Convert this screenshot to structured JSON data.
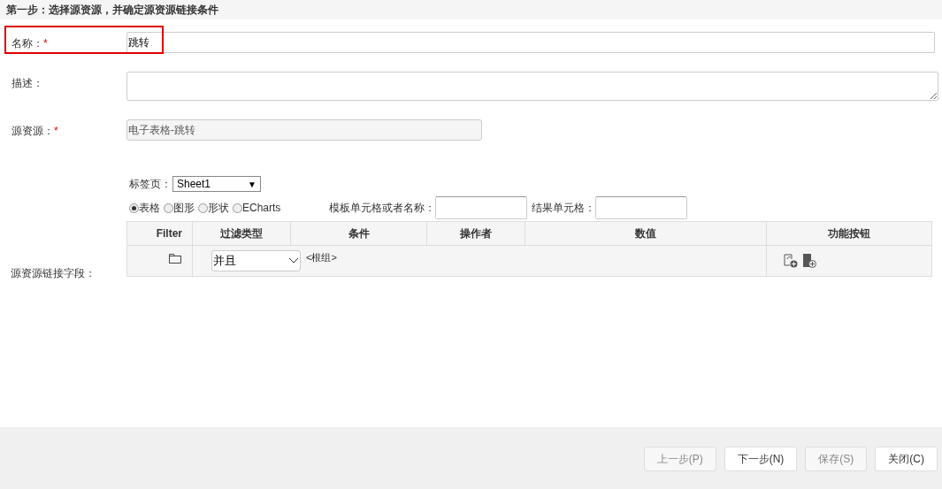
{
  "header": {
    "title": "第一步：选择源资源，并确定源资源链接条件"
  },
  "fields": [
    {
      "kind": "input",
      "label": "名称：",
      "required": "*",
      "value": "跳转",
      "highlighted": true
    },
    {
      "kind": "textarea",
      "label": "描述：",
      "highlighted": false
    },
    {
      "kind": "readonly",
      "label": "源资源：",
      "required": "*",
      "value": "电子表格-跳转",
      "highlighted": false
    }
  ],
  "link": {
    "label": "源资源链接字段：",
    "sheet_label": "标签页：",
    "sheet_value": "Sheet1",
    "sheet_caret": "▼",
    "radios": [
      {
        "label": "表格",
        "selected": true
      },
      {
        "label": "图形",
        "selected": false
      },
      {
        "label": "形状",
        "selected": false
      },
      {
        "label": "ECharts",
        "selected": false
      }
    ],
    "template_label": "模板单元格或者名称：",
    "result_label": "结果单元格：",
    "table": {
      "columns": [
        "Filter",
        "过滤类型",
        "条件",
        "操作者",
        "数值",
        "功能按钮"
      ],
      "rows": [
        {
          "filter_type": "并且",
          "condition": "<根组>"
        }
      ]
    }
  },
  "buttons": [
    {
      "label": "上一步(P)",
      "disabled": true
    },
    {
      "label": "下一步(N)",
      "disabled": false
    },
    {
      "label": "保存(S)",
      "disabled": true
    },
    {
      "label": "关闭(C)",
      "disabled": false
    }
  ]
}
